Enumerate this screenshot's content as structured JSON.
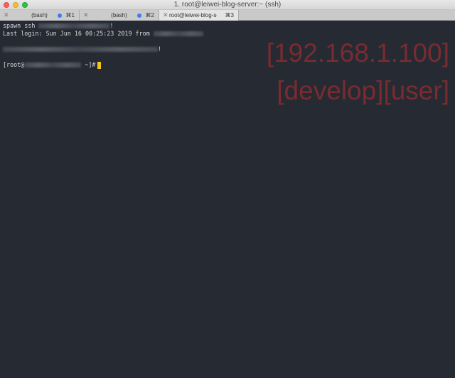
{
  "window": {
    "title": "1. root@leiwei-blog-server:~ (ssh)"
  },
  "tabs": [
    {
      "label": "(bash)",
      "shortcut": "⌘1",
      "active": false
    },
    {
      "label": "(bash)",
      "shortcut": "⌘2",
      "active": false
    },
    {
      "label": "root@leiwei-blog-ser...",
      "shortcut": "⌘3",
      "active": true
    }
  ],
  "terminal": {
    "line1_prefix": "spawn ssh ",
    "line1_suffix": "!",
    "line2_prefix": "Last login: Sun Jun 16 00:25:23 2019 from ",
    "line4_suffix": "!",
    "prompt_prefix": "[root@",
    "prompt_suffix": " ~]#"
  },
  "watermark": {
    "ip": "[192.168.1.100]",
    "env": "[develop][user]",
    "color": "#7a2b30"
  },
  "colors": {
    "background": "#262a33",
    "cursor": "#f5c518",
    "tab_indicator": "#3d7bf0"
  }
}
